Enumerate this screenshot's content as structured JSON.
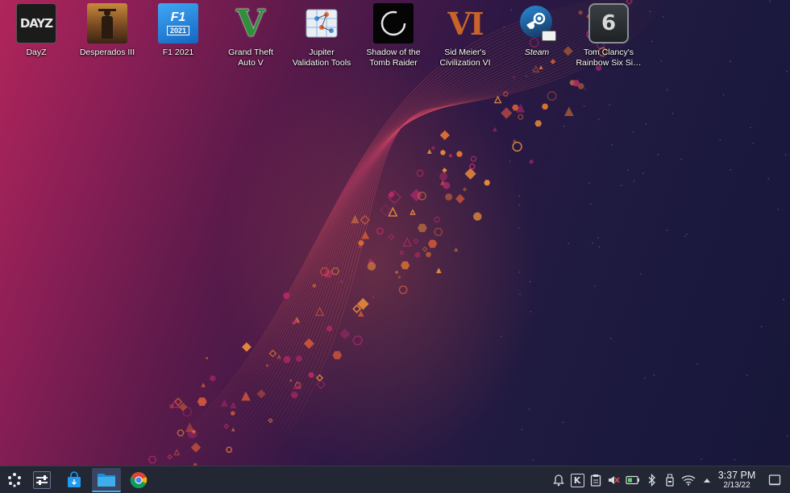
{
  "desktop": {
    "icons": [
      {
        "label": "DayZ",
        "name": "desktop-icon-dayz",
        "icon": "dayz-icon"
      },
      {
        "label": "Desperados III",
        "name": "desktop-icon-desperados-iii",
        "icon": "desperados-icon"
      },
      {
        "label": "F1 2021",
        "name": "desktop-icon-f1-2021",
        "icon": "f1-icon",
        "badge": "2021"
      },
      {
        "label": "Grand Theft\nAuto V",
        "name": "desktop-icon-gta-v",
        "icon": "gta-v-icon",
        "glyph": "V"
      },
      {
        "label": "Jupiter\nValidation Tools",
        "name": "desktop-icon-jupiter-validation-tools",
        "icon": "jupiter-icon"
      },
      {
        "label": "Shadow of the\nTomb Raider",
        "name": "desktop-icon-shadow-tomb-raider",
        "icon": "tomb-raider-icon"
      },
      {
        "label": "Sid Meier's\nCivilization VI",
        "name": "desktop-icon-civilization-vi",
        "icon": "civ-vi-icon",
        "glyph": "VI"
      },
      {
        "label": "Steam",
        "name": "desktop-icon-steam",
        "icon": "steam-icon"
      },
      {
        "label": "Tom Clancy's\nRainbow Six Si…",
        "name": "desktop-icon-rainbow-six-siege",
        "icon": "rainbow-six-icon",
        "glyph": "6"
      }
    ],
    "dayz_logo_text": "DAYZ"
  },
  "taskbar": {
    "launchers": [
      {
        "name": "application-launcher-button",
        "icon": "launcher-icon"
      },
      {
        "name": "system-settings-button",
        "icon": "settings-sliders-icon"
      },
      {
        "name": "discover-store-button",
        "icon": "shopping-bag-icon"
      },
      {
        "name": "file-manager-button",
        "icon": "folder-icon",
        "active": true
      },
      {
        "name": "chrome-button",
        "icon": "chrome-icon"
      }
    ],
    "tray": [
      {
        "name": "notifications-icon"
      },
      {
        "name": "kde-connect-icon"
      },
      {
        "name": "clipboard-icon"
      },
      {
        "name": "volume-muted-icon"
      },
      {
        "name": "battery-icon"
      },
      {
        "name": "bluetooth-icon"
      },
      {
        "name": "storage-device-icon"
      },
      {
        "name": "wifi-icon"
      },
      {
        "name": "tray-expand-arrow-icon"
      },
      {
        "name": "show-desktop-icon"
      }
    ],
    "clock": {
      "time": "3:37 PM",
      "date": "2/13/22"
    }
  },
  "colors": {
    "taskbar_bg": "#232633",
    "accent": "#3daee9",
    "wallpaper_left": "#b0255a",
    "wallpaper_right": "#17173a",
    "particle_orange": "#e8772e",
    "particle_magenta": "#c42a6a"
  }
}
